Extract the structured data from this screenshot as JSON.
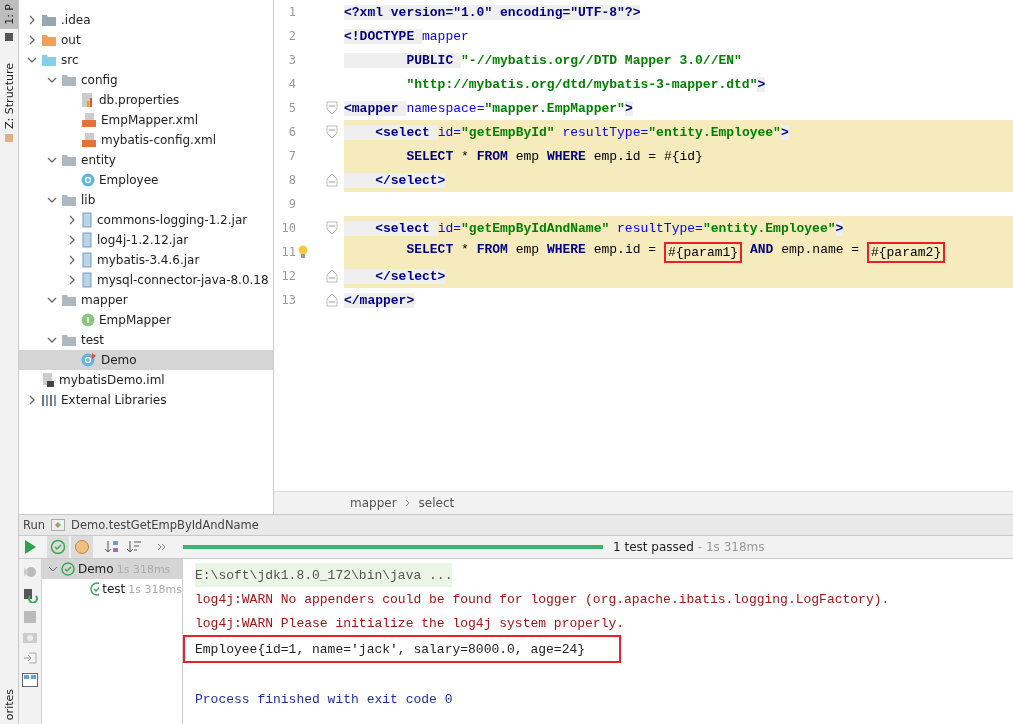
{
  "side_strip": {
    "top_tab": "1: P",
    "structure_tab": "Z: Structure",
    "bottom_tab": "orites"
  },
  "project_tree": [
    {
      "label": ".idea",
      "kind": "folder",
      "expanded": false,
      "selected": false
    },
    {
      "label": "out",
      "kind": "output",
      "expanded": false,
      "selected": false
    },
    {
      "label": "src",
      "kind": "source",
      "expanded": true,
      "selected": false,
      "children": [
        {
          "label": "config",
          "kind": "package",
          "expanded": true,
          "selected": false,
          "children": [
            {
              "label": "db.properties",
              "kind": "properties",
              "selected": false
            },
            {
              "label": "EmpMapper.xml",
              "kind": "xml",
              "selected": false
            },
            {
              "label": "mybatis-config.xml",
              "kind": "xml",
              "selected": false
            }
          ]
        },
        {
          "label": "entity",
          "kind": "package",
          "expanded": true,
          "selected": false,
          "children": [
            {
              "label": "Employee",
              "kind": "class",
              "selected": false
            }
          ]
        },
        {
          "label": "lib",
          "kind": "package",
          "expanded": true,
          "selected": false,
          "children": [
            {
              "label": "commons-logging-1.2.jar",
              "kind": "jar",
              "expanded": false,
              "selected": false
            },
            {
              "label": "log4j-1.2.12.jar",
              "kind": "jar",
              "expanded": false,
              "selected": false
            },
            {
              "label": "mybatis-3.4.6.jar",
              "kind": "jar",
              "expanded": false,
              "selected": false
            },
            {
              "label": "mysql-connector-java-8.0.18",
              "kind": "jar",
              "expanded": false,
              "selected": false
            }
          ]
        },
        {
          "label": "mapper",
          "kind": "package",
          "expanded": true,
          "selected": false,
          "children": [
            {
              "label": "EmpMapper",
              "kind": "interface",
              "selected": false
            }
          ]
        },
        {
          "label": "test",
          "kind": "package",
          "expanded": true,
          "selected": false,
          "children": [
            {
              "label": "Demo",
              "kind": "test",
              "selected": true
            }
          ]
        }
      ]
    },
    {
      "label": "mybatisDemo.iml",
      "kind": "module",
      "selected": false
    },
    {
      "label": "External Libraries",
      "kind": "libraries",
      "expanded": false,
      "selected": false
    }
  ],
  "editor": {
    "lines": [
      {
        "number": "1",
        "fold_start": false,
        "fold_end": false,
        "highlight": false,
        "bulb": false,
        "segments": [
          {
            "kind": "tag",
            "text": "<?xml version=\"1.0\" encoding=\"UTF-8\"?>"
          }
        ]
      },
      {
        "number": "2",
        "fold_start": false,
        "fold_end": false,
        "highlight": false,
        "bulb": false,
        "segments": [
          {
            "kind": "tag",
            "text": "<!DOCTYPE "
          },
          {
            "kind": "attr",
            "text": "mapper"
          }
        ]
      },
      {
        "number": "3",
        "fold_start": false,
        "fold_end": false,
        "highlight": false,
        "bulb": false,
        "segments": [
          {
            "kind": "tag",
            "text": "        PUBLIC "
          },
          {
            "kind": "string",
            "text": "\"-//mybatis.org//DTD Mapper 3.0//EN\""
          }
        ]
      },
      {
        "number": "4",
        "fold_start": false,
        "fold_end": false,
        "highlight": false,
        "bulb": false,
        "segments": [
          {
            "kind": "string",
            "text": "        \"http://mybatis.org/dtd/mybatis-3-mapper.dtd\""
          },
          {
            "kind": "tag",
            "text": ">"
          }
        ]
      },
      {
        "number": "5",
        "fold_start": true,
        "fold_end": false,
        "highlight": false,
        "bulb": false,
        "segments": [
          {
            "kind": "tag",
            "text": "<mapper "
          },
          {
            "kind": "attr",
            "text": "namespace="
          },
          {
            "kind": "string",
            "text": "\"mapper.EmpMapper\""
          },
          {
            "kind": "tag",
            "text": ">"
          }
        ]
      },
      {
        "number": "6",
        "fold_start": true,
        "fold_end": false,
        "highlight": true,
        "bulb": false,
        "segments": [
          {
            "kind": "tag",
            "text": "    <select "
          },
          {
            "kind": "attr",
            "text": "id="
          },
          {
            "kind": "string",
            "text": "\"getEmpById\" "
          },
          {
            "kind": "attr",
            "text": "resultType="
          },
          {
            "kind": "string",
            "text": "\"entity.Employee\""
          },
          {
            "kind": "tag",
            "text": ">"
          }
        ]
      },
      {
        "number": "7",
        "fold_start": false,
        "fold_end": false,
        "highlight": true,
        "bulb": false,
        "segments": [
          {
            "kind": "keyword",
            "text": "        SELECT "
          },
          {
            "kind": "plain",
            "text": "* "
          },
          {
            "kind": "keyword",
            "text": "FROM "
          },
          {
            "kind": "plain",
            "text": "emp "
          },
          {
            "kind": "keyword",
            "text": "WHERE "
          },
          {
            "kind": "plain",
            "text": "emp.id = #{id}"
          }
        ]
      },
      {
        "number": "8",
        "fold_start": false,
        "fold_end": true,
        "highlight": true,
        "bulb": false,
        "segments": [
          {
            "kind": "tag",
            "text": "    </select>"
          }
        ]
      },
      {
        "number": "9",
        "fold_start": false,
        "fold_end": false,
        "highlight": false,
        "bulb": false
      },
      {
        "number": "10",
        "fold_start": true,
        "fold_end": false,
        "highlight": true,
        "bulb": false,
        "segments": [
          {
            "kind": "tag",
            "text": "    <select "
          },
          {
            "kind": "attr",
            "text": "id="
          },
          {
            "kind": "string",
            "text": "\"getEmpByIdAndName\" "
          },
          {
            "kind": "attr",
            "text": "resultType="
          },
          {
            "kind": "string",
            "text": "\"entity.Employee\""
          },
          {
            "kind": "tag",
            "text": ">"
          }
        ]
      },
      {
        "number": "11",
        "fold_start": false,
        "fold_end": false,
        "highlight": true,
        "bulb": true,
        "segments": [
          {
            "kind": "keyword",
            "text": "        SELECT "
          },
          {
            "kind": "plain",
            "text": "* "
          },
          {
            "kind": "keyword",
            "text": "FROM "
          },
          {
            "kind": "plain",
            "text": "emp "
          },
          {
            "kind": "keyword",
            "text": "WHERE "
          },
          {
            "kind": "plain",
            "text": "emp.id = "
          },
          {
            "kind": "boxed",
            "text": "#{param1}"
          },
          {
            "kind": "keyword",
            "text": " AND "
          },
          {
            "kind": "plain",
            "text": "emp.name = "
          },
          {
            "kind": "boxed",
            "text": "#{param2}"
          }
        ]
      },
      {
        "number": "12",
        "fold_start": false,
        "fold_end": true,
        "highlight": true,
        "bulb": false,
        "segments": [
          {
            "kind": "tag",
            "text": "    </select>"
          }
        ]
      },
      {
        "number": "13",
        "fold_start": false,
        "fold_end": true,
        "highlight": false,
        "bulb": false,
        "segments": [
          {
            "kind": "tag",
            "text": "</mapper>"
          }
        ]
      }
    ],
    "breadcrumbs": [
      "mapper",
      "select"
    ]
  },
  "run": {
    "label": "Run",
    "config": "Demo.testGetEmpByIdAndName",
    "status": "1 test passed",
    "duration": "- 1s 318ms",
    "level": 1,
    "tests": [
      {
        "name": "Demo",
        "time": "1s 318ms",
        "selected": true,
        "children": [
          {
            "name": "test",
            "time": "1s 318ms",
            "selected": false
          }
        ]
      }
    ],
    "console": [
      {
        "kind": "command",
        "text": "E:\\soft\\jdk1.8.0_172\\bin\\java ..."
      },
      {
        "kind": "warn",
        "text": "log4j:WARN No appenders could be found for logger (org.apache.ibatis.logging.LogFactory)."
      },
      {
        "kind": "warn",
        "text": "log4j:WARN Please initialize the log4j system properly."
      },
      {
        "kind": "output",
        "text": "Employee{id=1, name='jack', salary=8000.0, age=24}",
        "boxed": true
      },
      {
        "kind": "blank"
      },
      {
        "kind": "info",
        "text": "Process finished with exit code 0"
      }
    ]
  }
}
